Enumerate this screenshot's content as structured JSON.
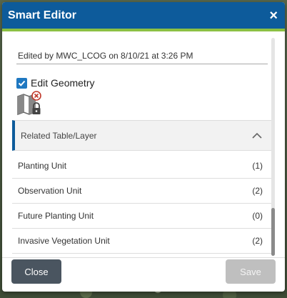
{
  "window": {
    "title": "Smart Editor",
    "close_glyph": "×"
  },
  "editor": {
    "edited_by": "Edited by MWC_LCOG on 8/10/21 at 3:26 PM",
    "edit_geometry_label": "Edit Geometry",
    "edit_geometry_checked": true
  },
  "related": {
    "header": "Related Table/Layer",
    "expanded": true,
    "items": [
      {
        "label": "Planting Unit",
        "count": "(1)"
      },
      {
        "label": "Observation Unit",
        "count": "(2)"
      },
      {
        "label": "Future Planting Unit",
        "count": "(0)"
      },
      {
        "label": "Invasive Vegetation Unit",
        "count": "(2)"
      }
    ]
  },
  "footer": {
    "close_label": "Close",
    "save_label": "Save",
    "save_enabled": false
  },
  "colors": {
    "titlebar": "#0d5b9b",
    "accent_strip": "#8cc043",
    "checkbox": "#1f78c1",
    "close_button": "#4a5560",
    "save_disabled": "#bfbfbf"
  }
}
